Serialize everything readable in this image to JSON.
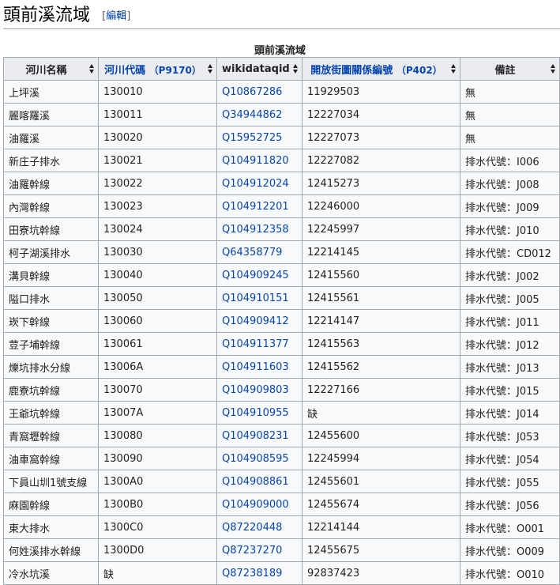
{
  "heading": {
    "title": "頭前溪流域",
    "edit_open": "[",
    "edit_label": "編輯",
    "edit_close": "]"
  },
  "table": {
    "caption": "頭前溪流域",
    "columns": [
      {
        "label": "河川名稱",
        "prop": ""
      },
      {
        "label": "河川代碼",
        "prop": "（P9170）"
      },
      {
        "label": "wikidataqid",
        "prop": ""
      },
      {
        "label": "開放街圖關係編號",
        "prop": "（P402）"
      },
      {
        "label": "備註",
        "prop": ""
      }
    ],
    "rows": [
      [
        "上坪溪",
        "130010",
        "Q10867286",
        "11929503",
        "無"
      ],
      [
        "麗喀羅溪",
        "130011",
        "Q34944862",
        "12227034",
        "無"
      ],
      [
        "油羅溪",
        "130020",
        "Q15952725",
        "12227073",
        "無"
      ],
      [
        "新庄子排水",
        "130021",
        "Q104911820",
        "12227082",
        "排水代號：I006"
      ],
      [
        "油羅幹線",
        "130022",
        "Q104912024",
        "12415273",
        "排水代號：J008"
      ],
      [
        "內灣幹線",
        "130023",
        "Q104912201",
        "12246000",
        "排水代號：J009"
      ],
      [
        "田寮坑幹線",
        "130024",
        "Q104912358",
        "12245997",
        "排水代號：J010"
      ],
      [
        "柯子湖溪排水",
        "130030",
        "Q64358779",
        "12214145",
        "排水代號：CD012"
      ],
      [
        "溝貝幹線",
        "130040",
        "Q104909245",
        "12415560",
        "排水代號：J002"
      ],
      [
        "隘口排水",
        "130050",
        "Q104910151",
        "12415561",
        "排水代號：J005"
      ],
      [
        "崁下幹線",
        "130060",
        "Q104909412",
        "12214147",
        "排水代號：J011"
      ],
      [
        "荳子埔幹線",
        "130061",
        "Q104911377",
        "12415563",
        "排水代號：J012"
      ],
      [
        "爍坑排水分線",
        "13006A",
        "Q104911603",
        "12415562",
        "排水代號：J013"
      ],
      [
        "鹿寮坑幹線",
        "130070",
        "Q104909803",
        "12227166",
        "排水代號：J015"
      ],
      [
        "王爺坑幹線",
        "13007A",
        "Q104910955",
        "缺",
        "排水代號：J014"
      ],
      [
        "青窩壢幹線",
        "130080",
        "Q104908231",
        "12455600",
        "排水代號：J053"
      ],
      [
        "油車窩幹線",
        "130090",
        "Q104908595",
        "12245994",
        "排水代號：J054"
      ],
      [
        "下員山圳1號支線",
        "1300A0",
        "Q104908861",
        "12455601",
        "排水代號：J055"
      ],
      [
        "麻園幹線",
        "1300B0",
        "Q104909000",
        "12455674",
        "排水代號：J056"
      ],
      [
        "東大排水",
        "1300C0",
        "Q87220448",
        "12214144",
        "排水代號：O001"
      ],
      [
        "何姓溪排水幹線",
        "1300D0",
        "Q87237270",
        "12455675",
        "排水代號：O009"
      ],
      [
        "冷水坑溪",
        "缺",
        "Q87238189",
        "92837423",
        "排水代號：O010"
      ]
    ]
  }
}
